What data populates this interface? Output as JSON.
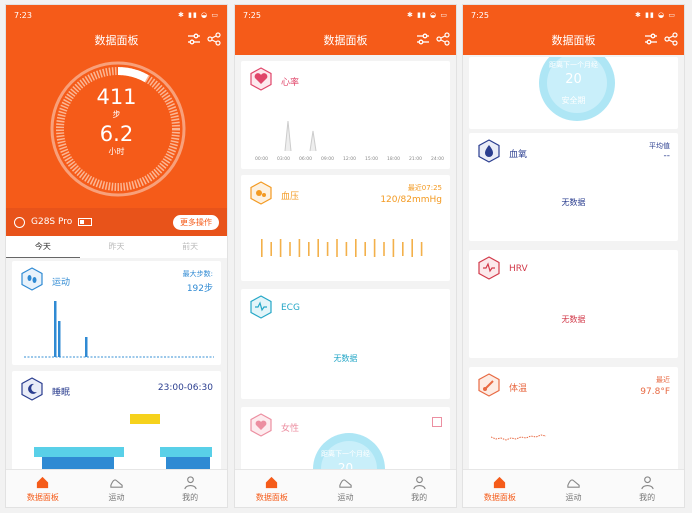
{
  "common": {
    "title": "数据面板",
    "tabs": [
      "数据面板",
      "运动",
      "我的"
    ]
  },
  "panel1": {
    "time": "7:23",
    "steps": "411",
    "steps_unit": "步",
    "hours": "6.2",
    "hours_unit": "小时",
    "device": "G28S Pro",
    "more_button": "更多操作",
    "day_tabs": [
      "今天",
      "昨天",
      "前天"
    ],
    "sport": {
      "title": "运动",
      "max_label": "最大步数:",
      "max_value": "192步"
    },
    "sleep": {
      "title": "睡眠",
      "range": "23:00-06:30"
    }
  },
  "panel2": {
    "time": "7:25",
    "heart": {
      "title": "心率",
      "ticks": [
        "00:00",
        "03:00",
        "06:00",
        "09:00",
        "12:00",
        "15:00",
        "18:00",
        "21:00",
        "24:00"
      ]
    },
    "bp": {
      "title": "血压",
      "recent": "最近07:25",
      "value": "120/82mmHg"
    },
    "ecg": {
      "title": "ECG",
      "nodata": "无数据"
    },
    "female": {
      "title": "女性",
      "bubble_text": "距离下一个月经",
      "bubble_num": "20"
    }
  },
  "panel3": {
    "time": "7:25",
    "bubble_text": "距离下一个月经",
    "bubble_num": "20",
    "bubble_sub": "安全期",
    "spo2": {
      "title": "血氧",
      "avg_label": "平均值",
      "avg_value": "--",
      "nodata": "无数据"
    },
    "hrv": {
      "title": "HRV",
      "nodata": "无数据"
    },
    "temp": {
      "title": "体温",
      "recent": "最近",
      "value": "97.8°F"
    }
  },
  "colors": {
    "accent": "#f55b19",
    "blue": "#2f8ad3",
    "orange": "#f39a22",
    "ecg": "#25a7c7",
    "red": "#d23a4a"
  }
}
